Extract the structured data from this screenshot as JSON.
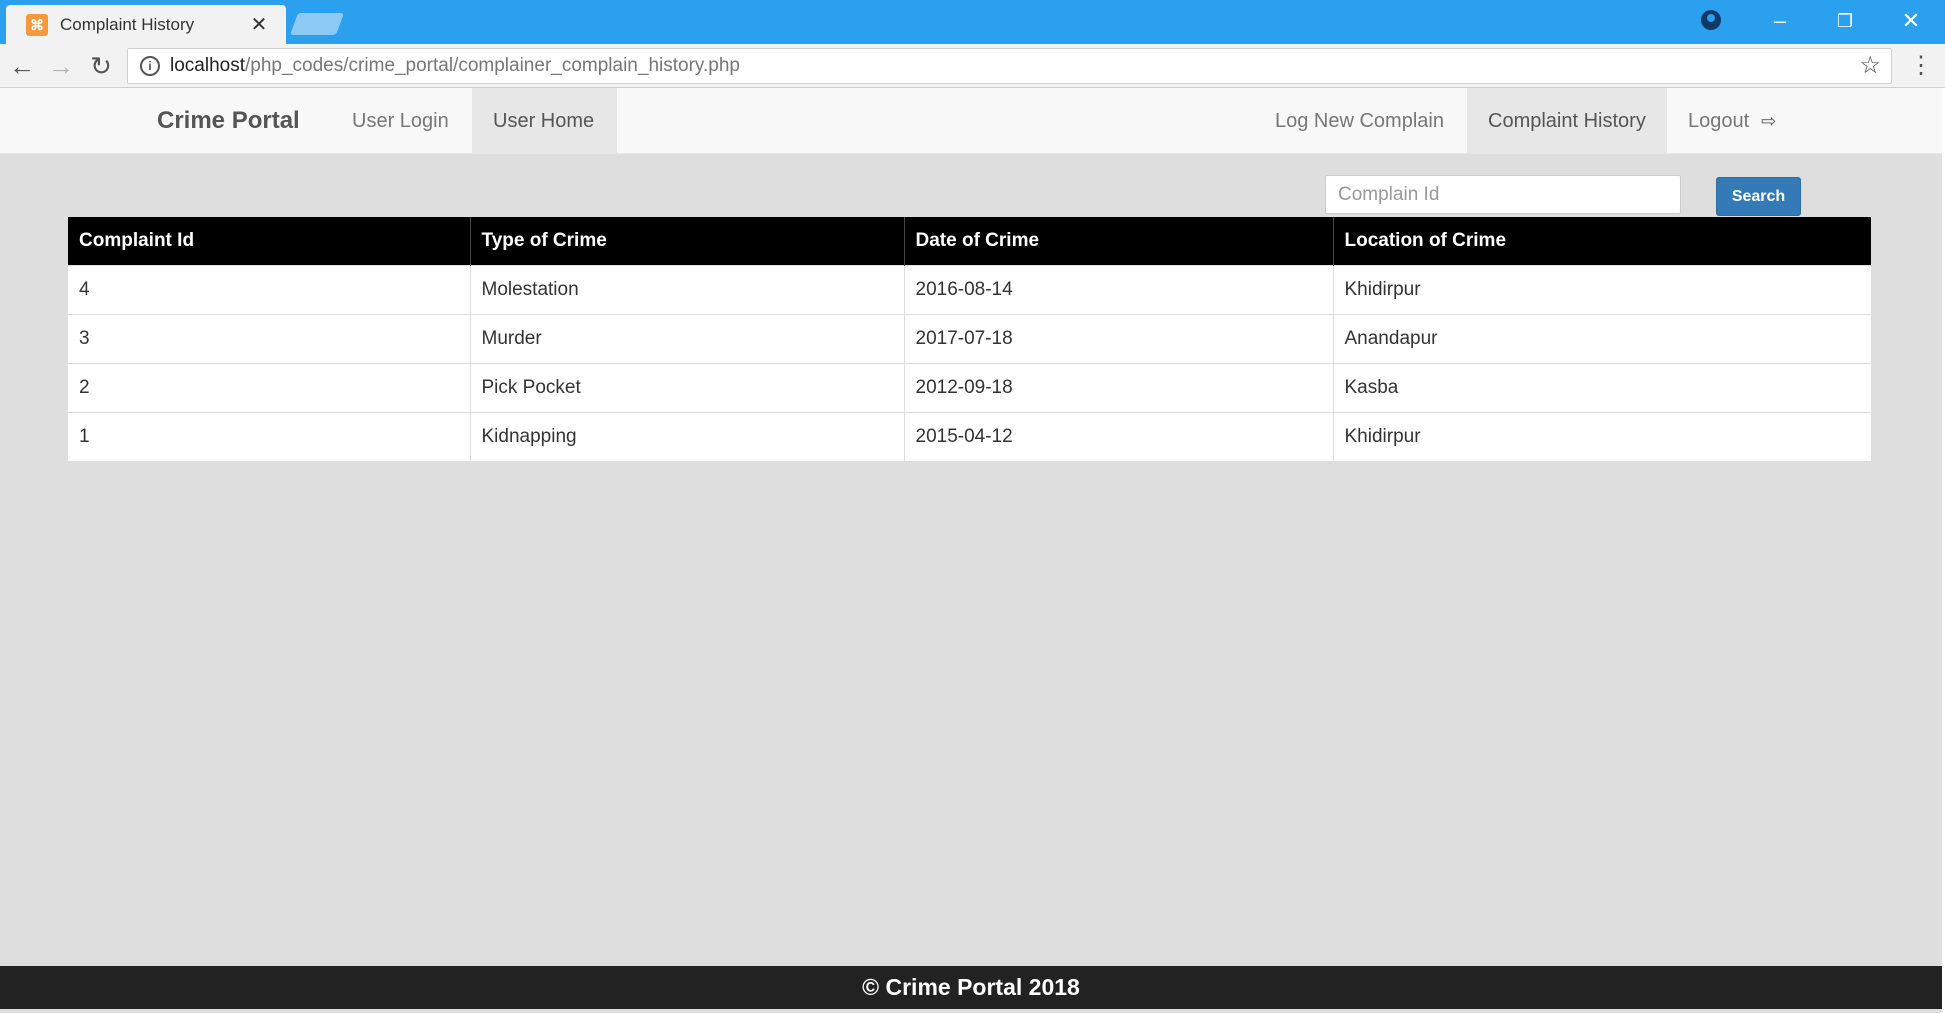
{
  "browser": {
    "tab_title": "Complaint History",
    "url_host": "localhost",
    "url_path": "/php_codes/crime_portal/complainer_complain_history.php",
    "accent_color": "#2aa0ef"
  },
  "navbar": {
    "brand": "Crime Portal",
    "left_items": [
      {
        "label": "User Login",
        "active": false
      },
      {
        "label": "User Home",
        "active": true
      }
    ],
    "right_items": [
      {
        "label": "Log New Complain",
        "active": false
      },
      {
        "label": "Complaint History",
        "active": true
      },
      {
        "label": "Logout",
        "active": false,
        "icon": "logout-icon"
      }
    ]
  },
  "search": {
    "placeholder": "Complain Id",
    "value": "",
    "button_label": "Search",
    "button_color": "#337ab7"
  },
  "table": {
    "headers": [
      "Complaint Id",
      "Type of Crime",
      "Date of Crime",
      "Location of Crime"
    ],
    "rows": [
      [
        "4",
        "Molestation",
        "2016-08-14",
        "Khidirpur"
      ],
      [
        "3",
        "Murder",
        "2017-07-18",
        "Anandapur"
      ],
      [
        "2",
        "Pick Pocket",
        "2012-09-18",
        "Kasba"
      ],
      [
        "1",
        "Kidnapping",
        "2015-04-12",
        "Khidirpur"
      ]
    ]
  },
  "footer": {
    "text": "© Crime Portal 2018"
  }
}
